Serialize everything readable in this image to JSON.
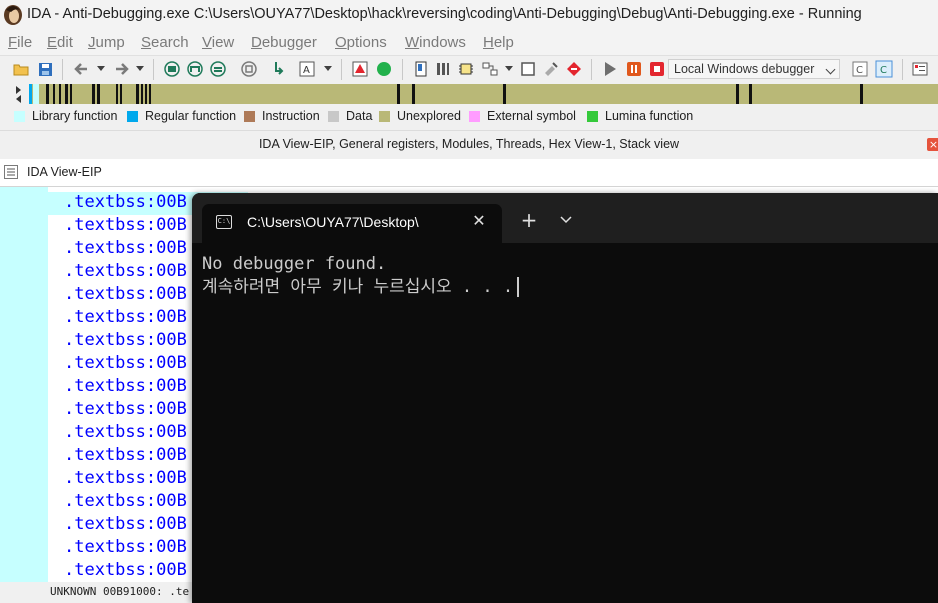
{
  "window": {
    "title": "IDA - Anti-Debugging.exe C:\\Users\\OUYA77\\Desktop\\hack\\reversing\\coding\\Anti-Debugging\\Debug\\Anti-Debugging.exe - Running",
    "icon": "ida-logo-icon"
  },
  "menu": {
    "items": [
      {
        "label": "File"
      },
      {
        "label": "Edit"
      },
      {
        "label": "Jump"
      },
      {
        "label": "Search"
      },
      {
        "label": "View"
      },
      {
        "label": "Debugger"
      },
      {
        "label": "Options"
      },
      {
        "label": "Windows"
      },
      {
        "label": "Help"
      }
    ]
  },
  "toolbar": {
    "debugger_select_value": "Local Windows debugger",
    "accent_colors": {
      "play": "#6e6e6e",
      "pause": "#e0581d",
      "stop": "#e3262f"
    }
  },
  "navigator": {
    "strip_color": "#b9b877"
  },
  "legend": {
    "items": [
      {
        "label": "Library function",
        "color": "#c6ffff"
      },
      {
        "label": "Regular function",
        "color": "#00a8ec"
      },
      {
        "label": "Instruction",
        "color": "#ae7a58"
      },
      {
        "label": "Data",
        "color": "#c8c8c8"
      },
      {
        "label": "Unexplored",
        "color": "#b9b877"
      },
      {
        "label": "External symbol",
        "color": "#ff9cff"
      },
      {
        "label": "Lumina function",
        "color": "#35c93b"
      }
    ]
  },
  "tabs": {
    "title": "IDA View-EIP, General registers, Modules, Threads, Hex View-1, Stack view",
    "close_symbol": "×"
  },
  "ida_view": {
    "title": "IDA View-EIP",
    "lines": [
      ".textbss:00B",
      ".textbss:00B",
      ".textbss:00B",
      ".textbss:00B",
      ".textbss:00B",
      ".textbss:00B",
      ".textbss:00B",
      ".textbss:00B",
      ".textbss:00B",
      ".textbss:00B",
      ".textbss:00B",
      ".textbss:00B",
      ".textbss:00B",
      ".textbss:00B",
      ".textbss:00B",
      ".textbss:00B",
      ".textbss:00B",
      ".textbss:00B"
    ]
  },
  "status": {
    "text": "UNKNOWN 00B91000: .te"
  },
  "terminal": {
    "tab_label": "C:\\Users\\OUYA77\\Desktop\\",
    "tab_close": "✕",
    "new_tab": "+",
    "output_line1": "No debugger found.",
    "output_line2": "계속하려면 아무 키나 누르십시오 . . ."
  }
}
